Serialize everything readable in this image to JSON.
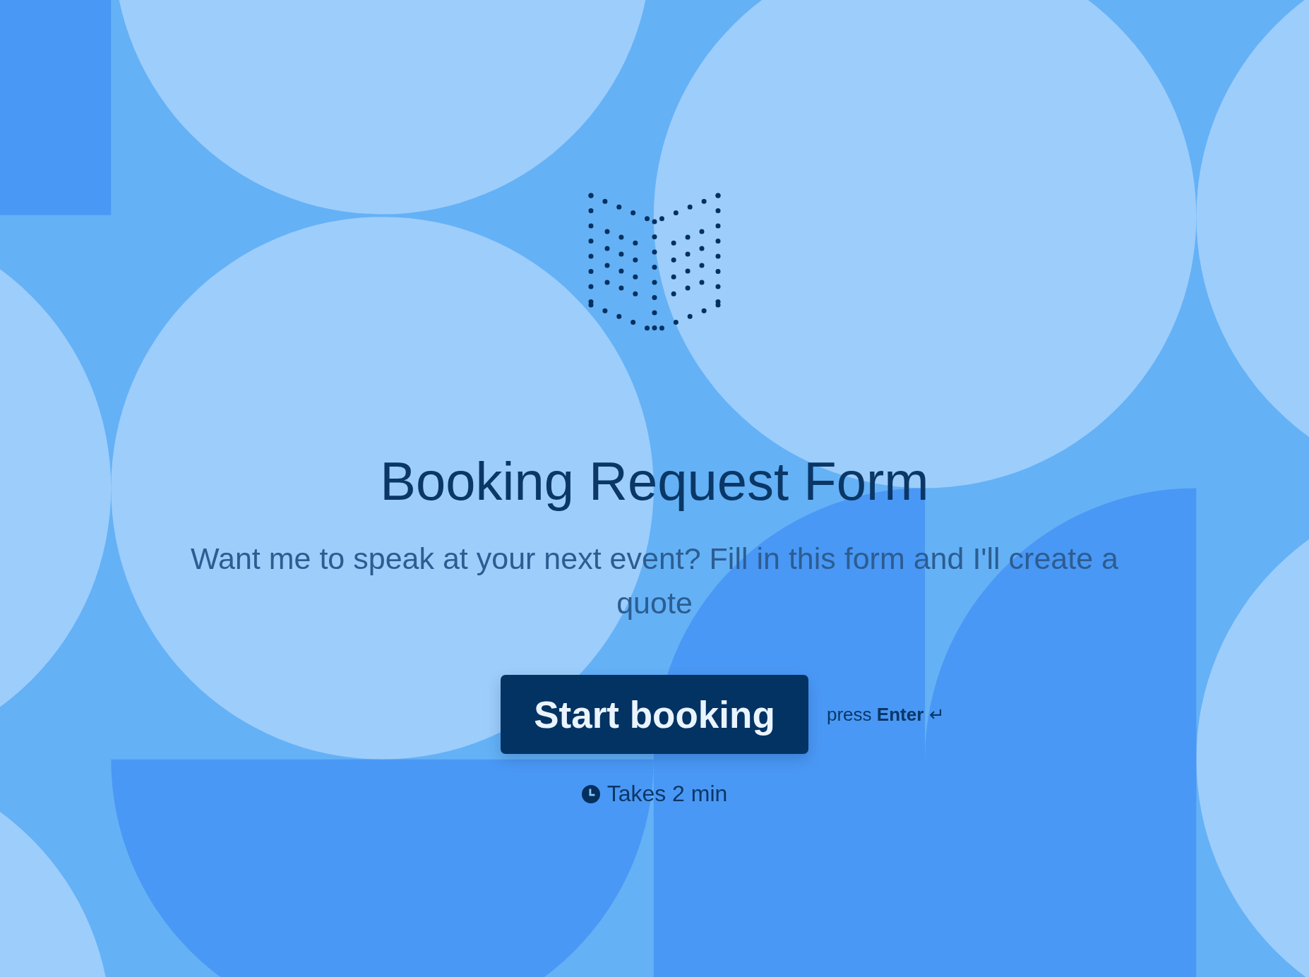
{
  "title": "Booking Request Form",
  "description": "Want me to speak at your next event? Fill in this form and I'll create a quote",
  "start_button": {
    "label": "Start booking"
  },
  "hint": {
    "text": "press **Enter** ↵"
  },
  "duration": "Takes 2 min"
}
